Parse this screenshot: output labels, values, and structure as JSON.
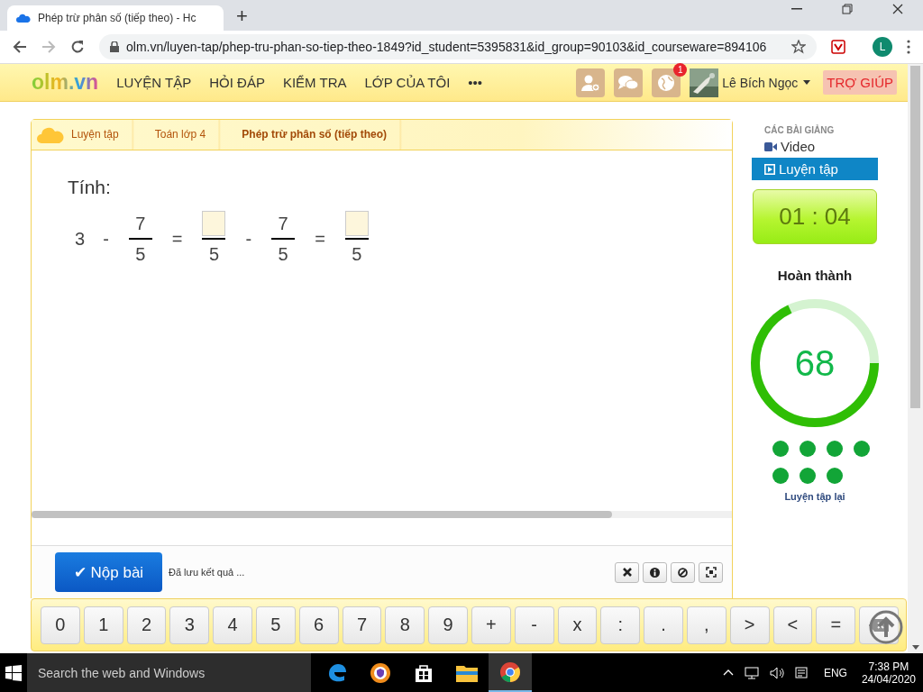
{
  "browser": {
    "tab_title": "Phép trừ phân số (tiếp theo) - Hc",
    "new_tab": "+",
    "url": "olm.vn/luyen-tap/phep-tru-phan-so-tiep-theo-1849?id_student=5395831&id_group=90103&id_courseware=894106",
    "profile": "L"
  },
  "site_header": {
    "logo": "olm.vn",
    "nav": [
      "LUYỆN TẬP",
      "HỎI ĐÁP",
      "KIỂM TRA",
      "LỚP CỦA TÔI",
      "•••"
    ],
    "notification_count": "1",
    "user_name": "Lê Bích Ngọc",
    "help": "TRỢ GIÚP"
  },
  "breadcrumb": [
    {
      "label": "Luyện tập",
      "selected": false
    },
    {
      "label": "Toán lớp 4",
      "selected": false
    },
    {
      "label": "Phép trừ phân số (tiếp theo)",
      "selected": true
    }
  ],
  "question": {
    "prompt": "Tính:",
    "equation": [
      {
        "kind": "number",
        "text": "3"
      },
      {
        "kind": "operator",
        "text": "-"
      },
      {
        "kind": "fraction",
        "numerator": "7",
        "denominator": "5"
      },
      {
        "kind": "operator",
        "text": "="
      },
      {
        "kind": "blank",
        "denominator": "5"
      },
      {
        "kind": "operator",
        "text": "-"
      },
      {
        "kind": "fraction",
        "numerator": "7",
        "denominator": "5"
      },
      {
        "kind": "operator",
        "text": "="
      },
      {
        "kind": "blank",
        "denominator": "5"
      }
    ]
  },
  "footer": {
    "submit": "✔ Nộp bài",
    "status": "Đã lưu kết quả ..."
  },
  "keypad": [
    {
      "kind": "char",
      "text": "0"
    },
    {
      "kind": "char",
      "text": "1"
    },
    {
      "kind": "char",
      "text": "2"
    },
    {
      "kind": "char",
      "text": "3"
    },
    {
      "kind": "char",
      "text": "4"
    },
    {
      "kind": "char",
      "text": "5"
    },
    {
      "kind": "char",
      "text": "6"
    },
    {
      "kind": "char",
      "text": "7"
    },
    {
      "kind": "char",
      "text": "8"
    },
    {
      "kind": "char",
      "text": "9"
    },
    {
      "kind": "char",
      "text": "+"
    },
    {
      "kind": "char",
      "text": "-"
    },
    {
      "kind": "char",
      "text": "x"
    },
    {
      "kind": "char",
      "text": ":"
    },
    {
      "kind": "char",
      "text": "."
    },
    {
      "kind": "char",
      "text": ","
    },
    {
      "kind": "char",
      "text": ">"
    },
    {
      "kind": "char",
      "text": "<"
    },
    {
      "kind": "char",
      "text": "="
    },
    {
      "kind": "backspace"
    }
  ],
  "sidebar": {
    "heading": "CÁC BÀI GIẢNG",
    "items": [
      {
        "kind": "video",
        "label": "Video",
        "selected": false
      },
      {
        "kind": "practice",
        "label": "Luyện tập",
        "selected": true
      }
    ],
    "timer": "01 : 04",
    "progress_title": "Hoàn thành",
    "progress": {
      "level": 0.68,
      "reading": "68"
    },
    "result_dots": [
      {
        "color": "#12a537"
      },
      {
        "color": "#12a537"
      },
      {
        "color": "#12a537"
      },
      {
        "color": "#12a537"
      },
      {
        "color": "#12a537"
      },
      {
        "color": "#12a537"
      },
      {
        "color": "#12a537"
      }
    ],
    "retry": "Luyện tập lại"
  },
  "taskbar": {
    "search_placeholder": "Search the web and Windows",
    "language": "ENG",
    "time": "7:38 PM",
    "date": "24/04/2020"
  }
}
